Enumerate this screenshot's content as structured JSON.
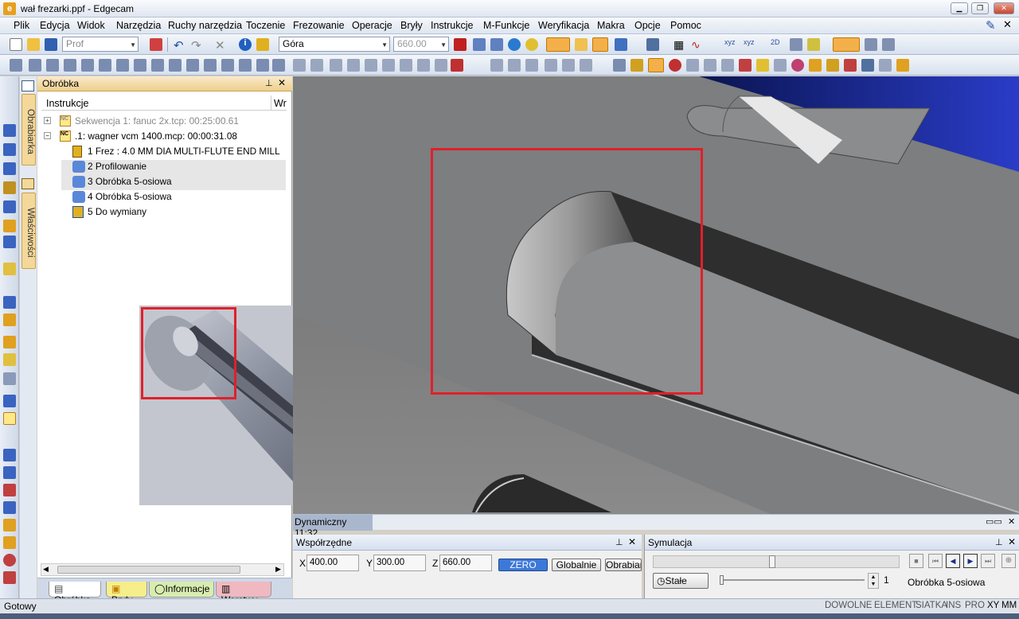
{
  "window": {
    "title": "wał frezarki.ppf - Edgecam"
  },
  "menu": [
    "Plik",
    "Edycja",
    "Widok",
    "Narzędzia",
    "Ruchy narzędzia",
    "Toczenie",
    "Frezowanie",
    "Operacje",
    "Bryły",
    "Instrukcje",
    "M-Funkcje",
    "Weryfikacja",
    "Makra",
    "Opcje",
    "Pomoc"
  ],
  "toolbar": {
    "layer_combo": "Prof",
    "view_combo": "Góra",
    "z_combo": "660.00"
  },
  "panel": {
    "title": "Obróbka",
    "column_1": "Instrukcje",
    "column_2": "Wr",
    "tree": [
      "Sekwencja 1: fanuc 2x.tcp: 00:25:00.61",
      ".1: wagner vcm 1400.mcp: 00:00:31.08",
      "1 Frez : 4.0 MM DIA MULTI-FLUTE END MILL",
      "2 Profilowanie",
      "3 Obróbka 5-osiowa",
      "4 Obróbka 5-osiowa",
      "5 Do wymiany"
    ],
    "tabs": [
      "Obróbka",
      "Bryły",
      "Informacje",
      "Warstwy"
    ]
  },
  "side_tabs": [
    "Obrabiarka",
    "Właściwości"
  ],
  "viewport": {
    "dyn_label": "Dynamiczny 11:32"
  },
  "coords": {
    "title": "Współrzędne",
    "x_label": "X",
    "x": "400.00",
    "y_label": "Y",
    "y": "300.00",
    "z_label": "Z",
    "z": "660.00",
    "zero": "ZERO",
    "global": "Globalnie",
    "machine": "Obrabiar"
  },
  "sim": {
    "title": "Symulacja",
    "mode": "Stałe",
    "step": "1",
    "current_op": "Obróbka 5-osiowa"
  },
  "status": {
    "text": "Gotowy",
    "flags": [
      "DOWOLNE",
      "ELEMENT",
      "SIATKA",
      "INS",
      "PRO",
      "XY",
      "MM"
    ]
  },
  "colors": {
    "highlight_box": "#e0202a",
    "panel_header": "#eecf8c",
    "sky": "#1a2fa0"
  }
}
